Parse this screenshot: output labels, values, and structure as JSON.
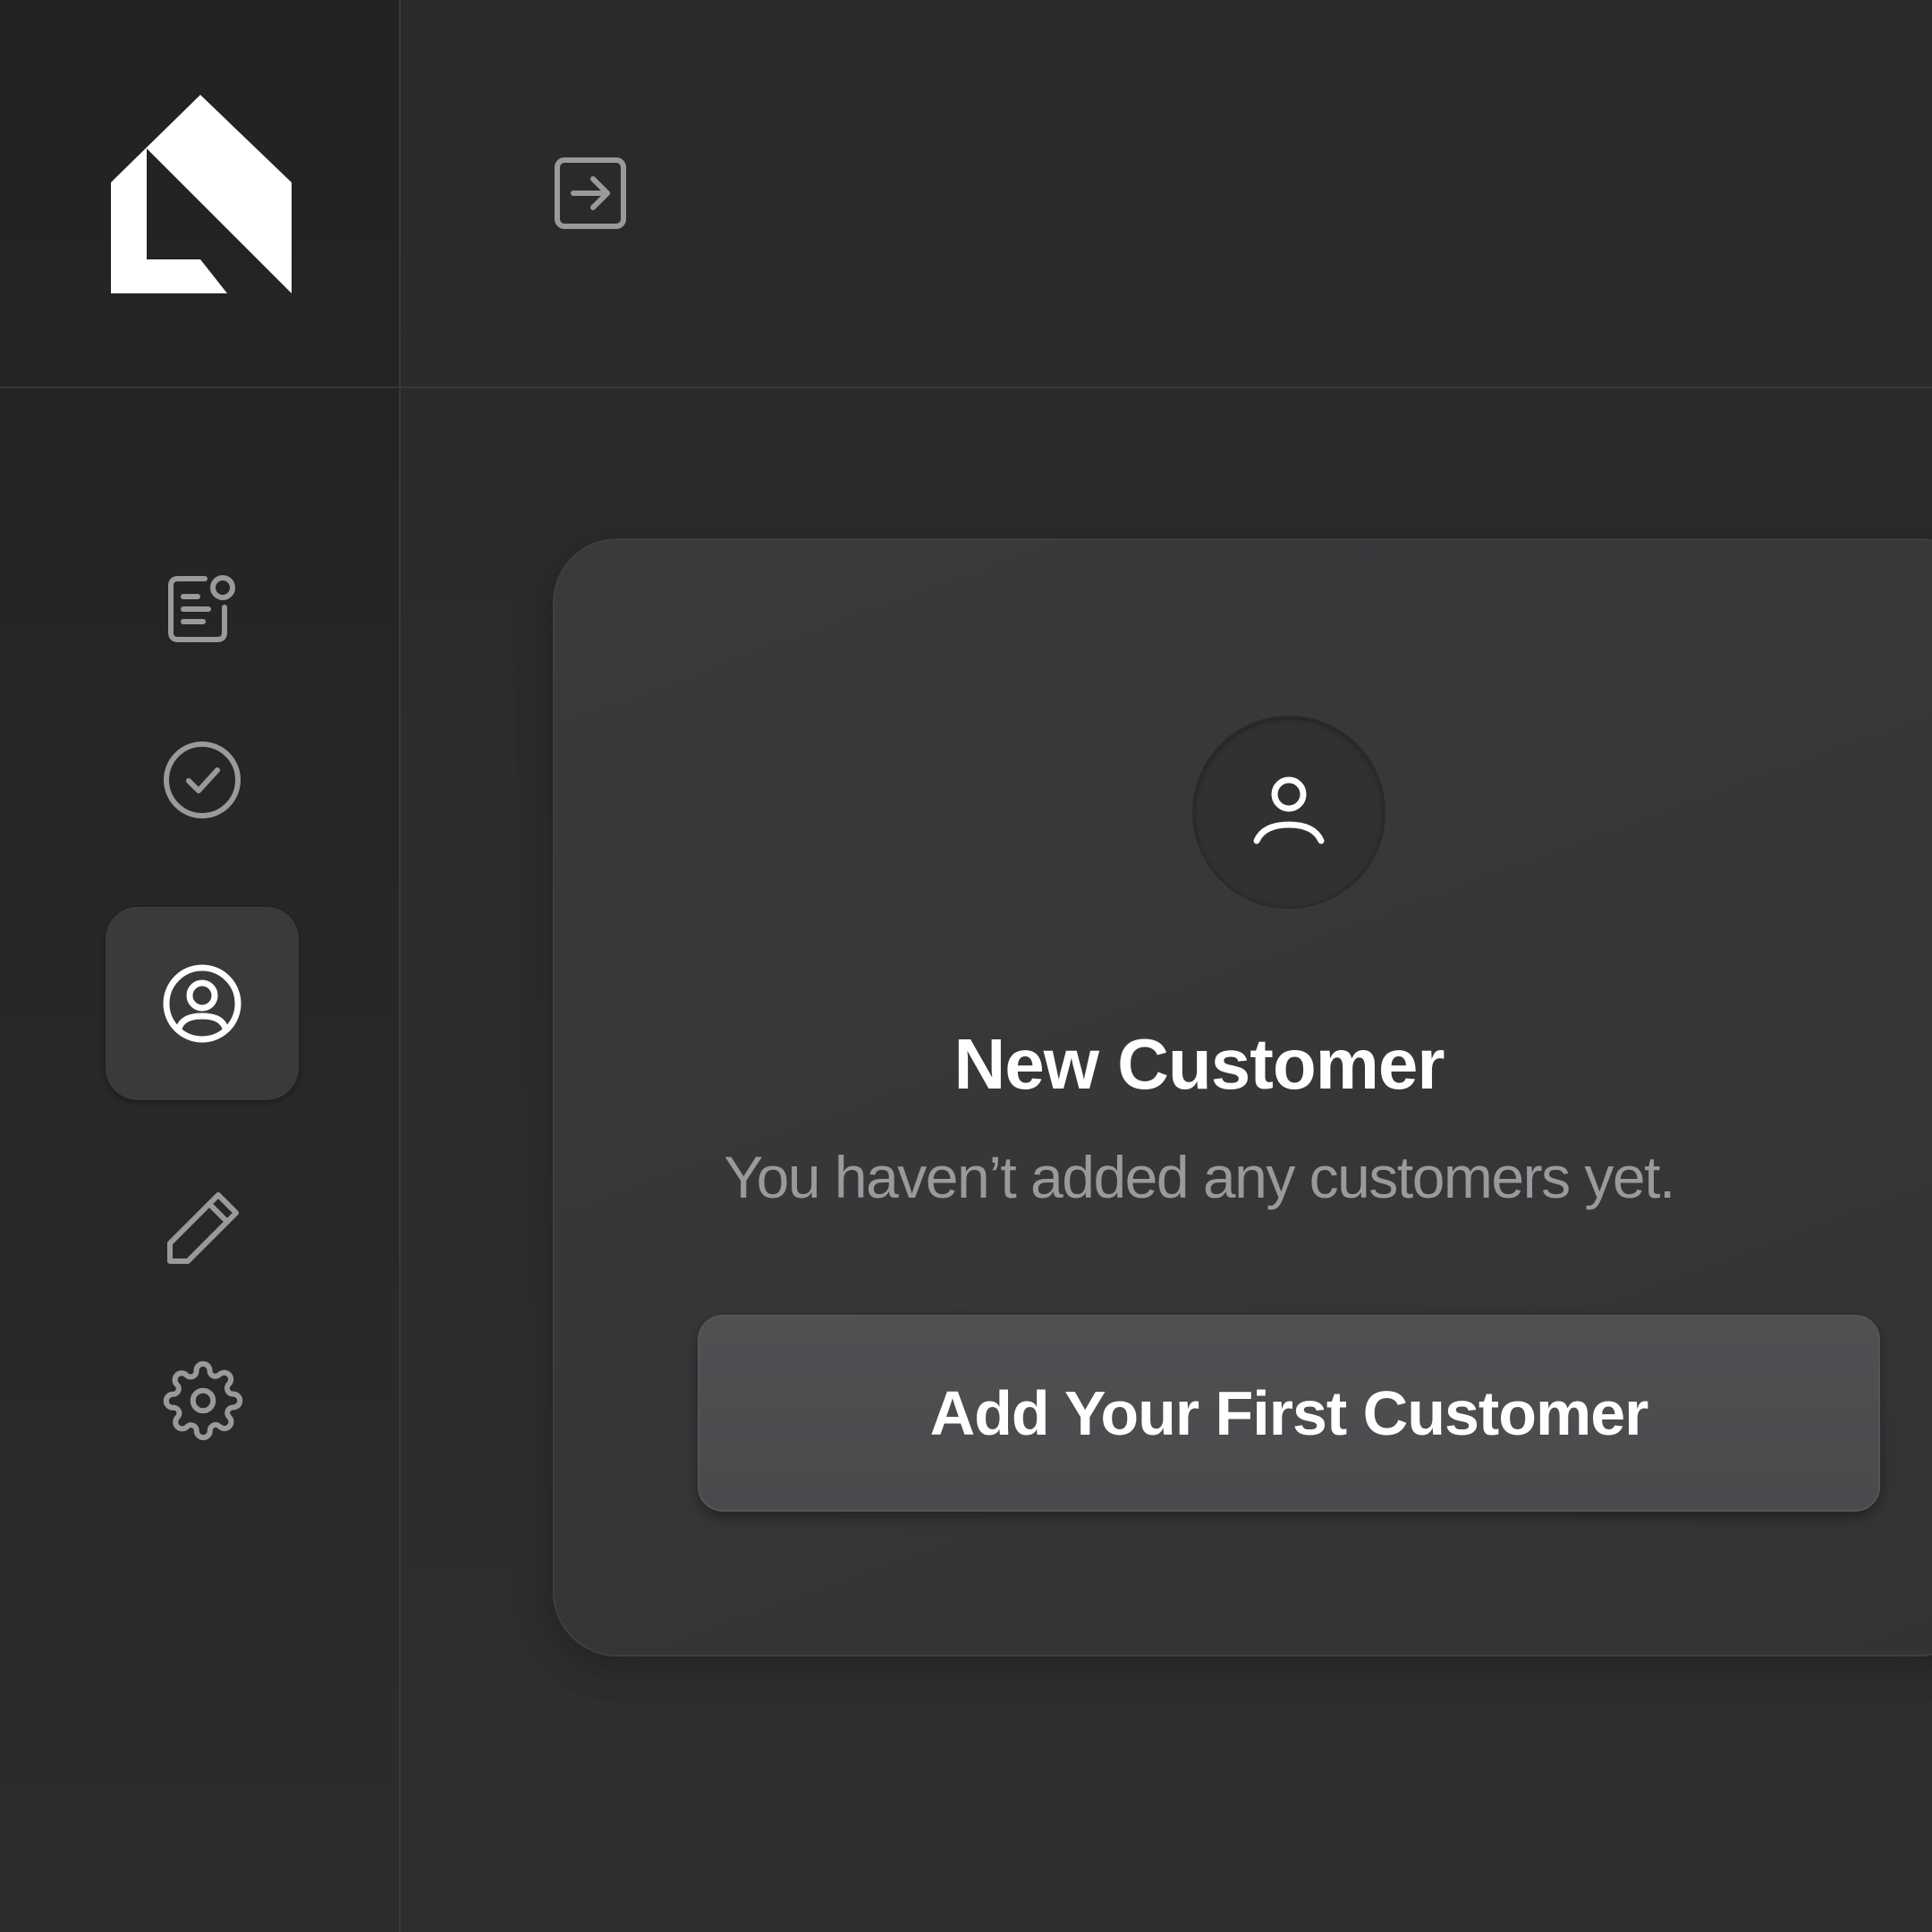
{
  "colors": {
    "background": "#2b2b2d",
    "sidebar": "#242426",
    "card": "#38383a",
    "button": "#4d4d50",
    "icon": "#9a9a9d",
    "text_primary": "#ffffff",
    "text_secondary": "#9a9a9d"
  },
  "sidebar": {
    "logo": "app-logo",
    "items": [
      {
        "icon": "notes-icon",
        "active": false
      },
      {
        "icon": "check-circle-icon",
        "active": false
      },
      {
        "icon": "user-circle-icon",
        "active": true
      },
      {
        "icon": "pencil-icon",
        "active": false
      },
      {
        "icon": "gear-icon",
        "active": false
      }
    ]
  },
  "topbar": {
    "expand_icon": "arrow-right-square-icon"
  },
  "empty_state": {
    "icon": "user-icon",
    "title": "New Customer",
    "subtitle": "You haven’t added any customers yet.",
    "button_label": "Add Your First Customer"
  }
}
